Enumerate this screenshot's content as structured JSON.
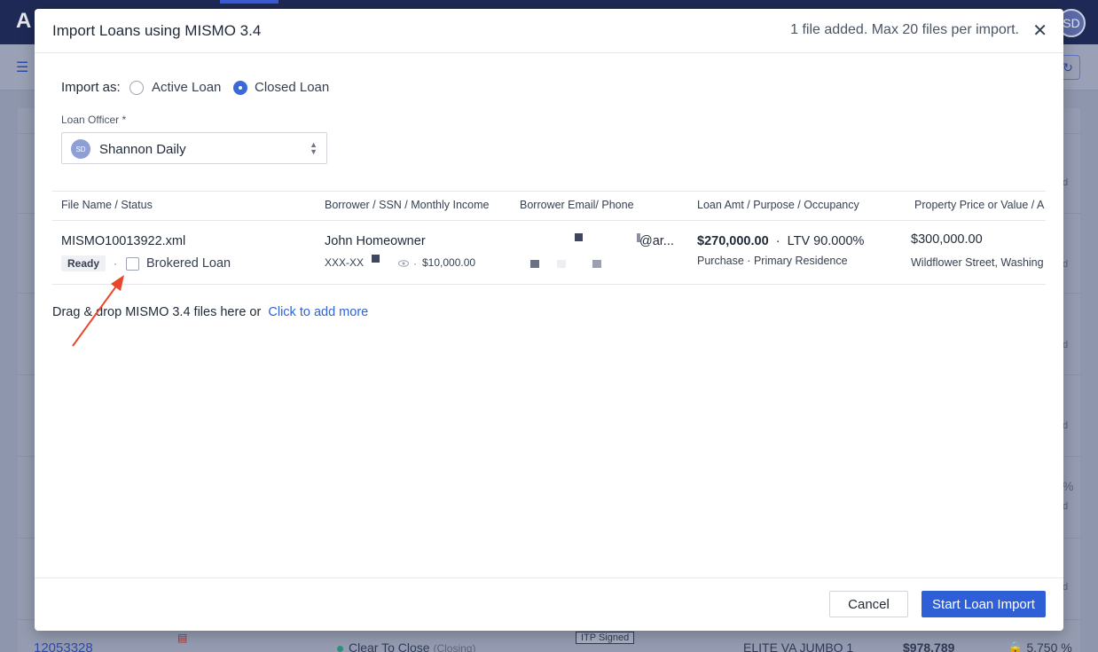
{
  "background": {
    "logo_letter": "A",
    "avatar_initials": "SD",
    "right_cell_letters": [
      "d",
      "d",
      "d",
      "d",
      "d",
      "d",
      "d"
    ],
    "right_cell_percent": "%",
    "bottom_row": {
      "loan_number": "12053328",
      "status": "Clear To Close",
      "status_sub": "(Closing)",
      "badge": "ITP Signed",
      "product": "ELITE VA JUMBO 1",
      "price": "$978,789",
      "rate": "5.750 %"
    }
  },
  "modal": {
    "title": "Import Loans using MISMO 3.4",
    "info": "1 file added. Max 20 files per import.",
    "close_symbol": "✕",
    "import_as": {
      "label": "Import as:",
      "options": [
        "Active Loan",
        "Closed Loan"
      ],
      "selected": "Closed Loan"
    },
    "loan_officer": {
      "label": "Loan Officer *",
      "initials": "SD",
      "value": "Shannon Daily"
    },
    "table": {
      "headers": [
        "File Name / Status",
        "Borrower / SSN / Monthly Income",
        "Borrower Email/ Phone",
        "Loan Amt / Purpose / Occupancy",
        "Property Price or Value / A"
      ],
      "rows": [
        {
          "file_name": "MISMO10013922.xml",
          "status": "Ready",
          "separator": "·",
          "brokered_label": "Brokered Loan",
          "brokered_checked": false,
          "borrower": "John Homeowner",
          "ssn": "XXX-XX",
          "income_sep": "·",
          "income": "$10,000.00",
          "email_fragment": "@ar...",
          "loan_amount": "$270,000.00",
          "ltv_sep": "·",
          "ltv": "LTV 90.000%",
          "purpose": "Purchase",
          "occ_sep": "·",
          "occupancy": "Primary Residence",
          "property_price": "$300,000.00",
          "address": "Wildflower Street, Washing"
        }
      ]
    },
    "dropzone": {
      "text": "Drag & drop MISMO 3.4 files here or",
      "link": "Click to add more"
    },
    "buttons": {
      "cancel": "Cancel",
      "start": "Start Loan Import"
    }
  },
  "colors": {
    "accent": "#2f5fd6",
    "annotation_arrow": "#e8472b",
    "overlay": "#8e96ad"
  }
}
